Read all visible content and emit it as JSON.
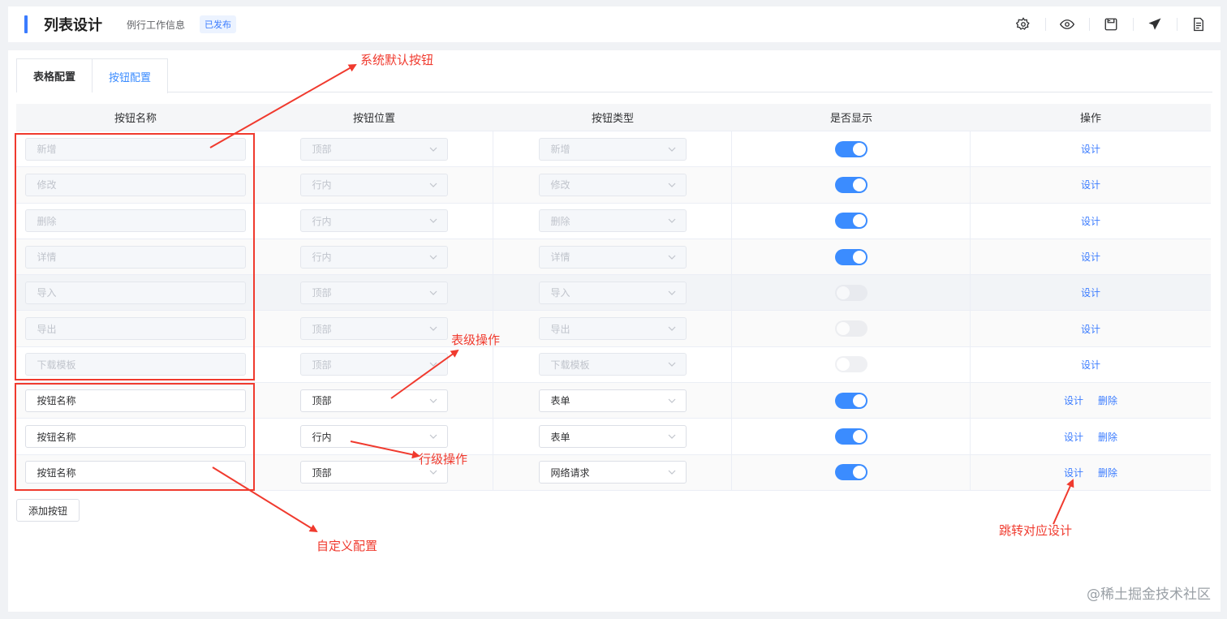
{
  "header": {
    "title": "列表设计",
    "subtitle": "例行工作信息",
    "badge": "已发布",
    "tools": [
      "settings-icon",
      "eye-icon",
      "save-icon",
      "send-icon",
      "document-icon"
    ]
  },
  "tabs": [
    {
      "label": "表格配置",
      "active": false
    },
    {
      "label": "按钮配置",
      "active": true
    }
  ],
  "table": {
    "columns": [
      "按钮名称",
      "按钮位置",
      "按钮类型",
      "是否显示",
      "操作"
    ],
    "rows": [
      {
        "name": "新增",
        "position": "顶部",
        "type": "新增",
        "visible": true,
        "actions": [
          "设计"
        ]
      },
      {
        "name": "修改",
        "position": "行内",
        "type": "修改",
        "visible": true,
        "actions": [
          "设计"
        ]
      },
      {
        "name": "删除",
        "position": "行内",
        "type": "删除",
        "visible": true,
        "actions": [
          "设计"
        ]
      },
      {
        "name": "详情",
        "position": "行内",
        "type": "详情",
        "visible": true,
        "actions": [
          "设计"
        ]
      },
      {
        "name": "导入",
        "position": "顶部",
        "type": "导入",
        "visible": false,
        "actions": [
          "设计"
        ]
      },
      {
        "name": "导出",
        "position": "顶部",
        "type": "导出",
        "visible": false,
        "actions": [
          "设计"
        ]
      },
      {
        "name": "下载模板",
        "position": "顶部",
        "type": "下载模板",
        "visible": false,
        "actions": [
          "设计"
        ]
      },
      {
        "name": "按钮名称",
        "position": "顶部",
        "type": "表单",
        "visible": true,
        "actions": [
          "设计",
          "删除"
        ]
      },
      {
        "name": "按钮名称",
        "position": "行内",
        "type": "表单",
        "visible": true,
        "actions": [
          "设计",
          "删除"
        ]
      },
      {
        "name": "按钮名称",
        "position": "顶部",
        "type": "网络请求",
        "visible": true,
        "actions": [
          "设计",
          "删除"
        ]
      }
    ]
  },
  "add_button": "添加按钮",
  "annotations": {
    "system_default": "系统默认按钮",
    "table_level": "表级操作",
    "row_level": "行级操作",
    "custom": "自定义配置",
    "jump_design": "跳转对应设计"
  },
  "watermark": "@稀土掘金技术社区",
  "colors": {
    "accent": "#3b8cff",
    "annotation": "#f03a2e"
  }
}
